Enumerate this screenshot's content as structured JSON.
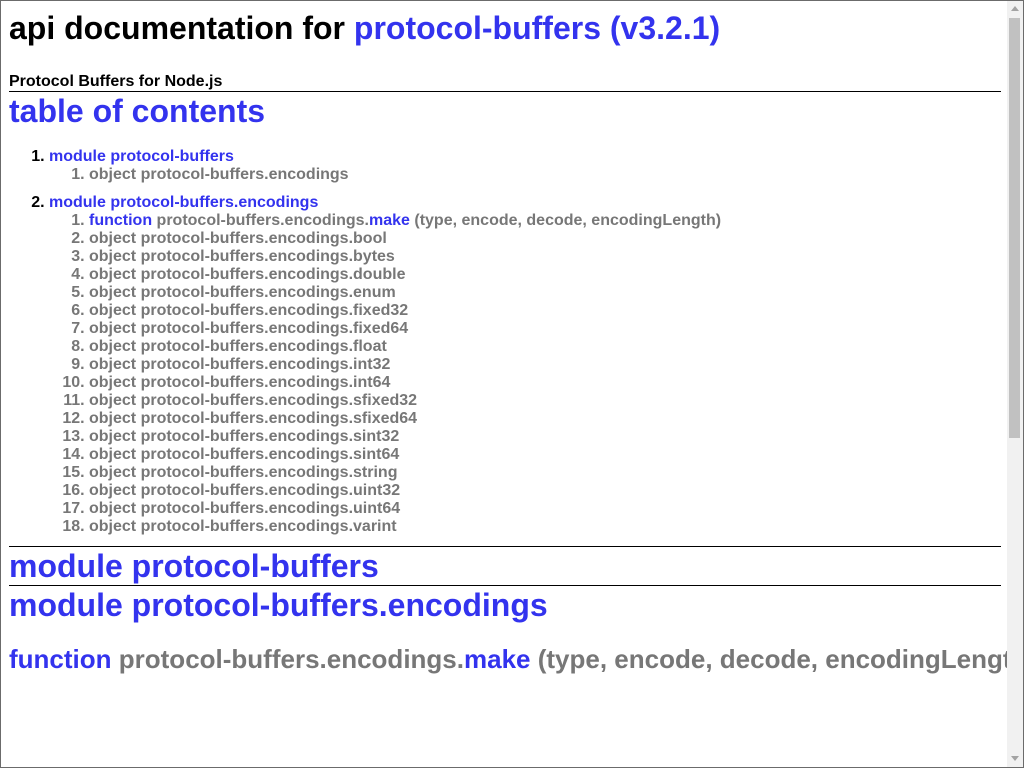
{
  "header": {
    "title_prefix": "api documentation for ",
    "title_link": "protocol-buffers (v3.2.1)",
    "subtitle": "Protocol Buffers for Node.js"
  },
  "toc": {
    "heading": "table of contents",
    "modules": [
      {
        "label": "module protocol-buffers",
        "items": [
          {
            "kind": "object",
            "name": "protocol-buffers.encodings"
          }
        ]
      },
      {
        "label": "module protocol-buffers.encodings",
        "function_item": {
          "keyword": "function",
          "prefix": "protocol-buffers.encodings.",
          "name": "make",
          "args": "(type, encode, decode, encodingLength)"
        },
        "items": [
          {
            "kind": "object",
            "name": "protocol-buffers.encodings.bool"
          },
          {
            "kind": "object",
            "name": "protocol-buffers.encodings.bytes"
          },
          {
            "kind": "object",
            "name": "protocol-buffers.encodings.double"
          },
          {
            "kind": "object",
            "name": "protocol-buffers.encodings.enum"
          },
          {
            "kind": "object",
            "name": "protocol-buffers.encodings.fixed32"
          },
          {
            "kind": "object",
            "name": "protocol-buffers.encodings.fixed64"
          },
          {
            "kind": "object",
            "name": "protocol-buffers.encodings.float"
          },
          {
            "kind": "object",
            "name": "protocol-buffers.encodings.int32"
          },
          {
            "kind": "object",
            "name": "protocol-buffers.encodings.int64"
          },
          {
            "kind": "object",
            "name": "protocol-buffers.encodings.sfixed32"
          },
          {
            "kind": "object",
            "name": "protocol-buffers.encodings.sfixed64"
          },
          {
            "kind": "object",
            "name": "protocol-buffers.encodings.sint32"
          },
          {
            "kind": "object",
            "name": "protocol-buffers.encodings.sint64"
          },
          {
            "kind": "object",
            "name": "protocol-buffers.encodings.string"
          },
          {
            "kind": "object",
            "name": "protocol-buffers.encodings.uint32"
          },
          {
            "kind": "object",
            "name": "protocol-buffers.encodings.uint64"
          },
          {
            "kind": "object",
            "name": "protocol-buffers.encodings.varint"
          }
        ]
      }
    ]
  },
  "sections": {
    "module_1": "module protocol-buffers",
    "module_2": "module protocol-buffers.encodings",
    "partial_function": {
      "keyword": "function",
      "prefix": "protocol-buffers.encodings.",
      "name": "make",
      "args": "(type, encode, decode, encodingLength)"
    }
  },
  "colors": {
    "link": "#3333ee",
    "muted": "#777777",
    "text": "#000000",
    "scrollbar_track": "#f1f1f1",
    "scrollbar_thumb": "#c1c1c1"
  },
  "icons": {
    "scroll_up": "scroll-up-arrow-icon",
    "scroll_down": "scroll-down-arrow-icon"
  }
}
